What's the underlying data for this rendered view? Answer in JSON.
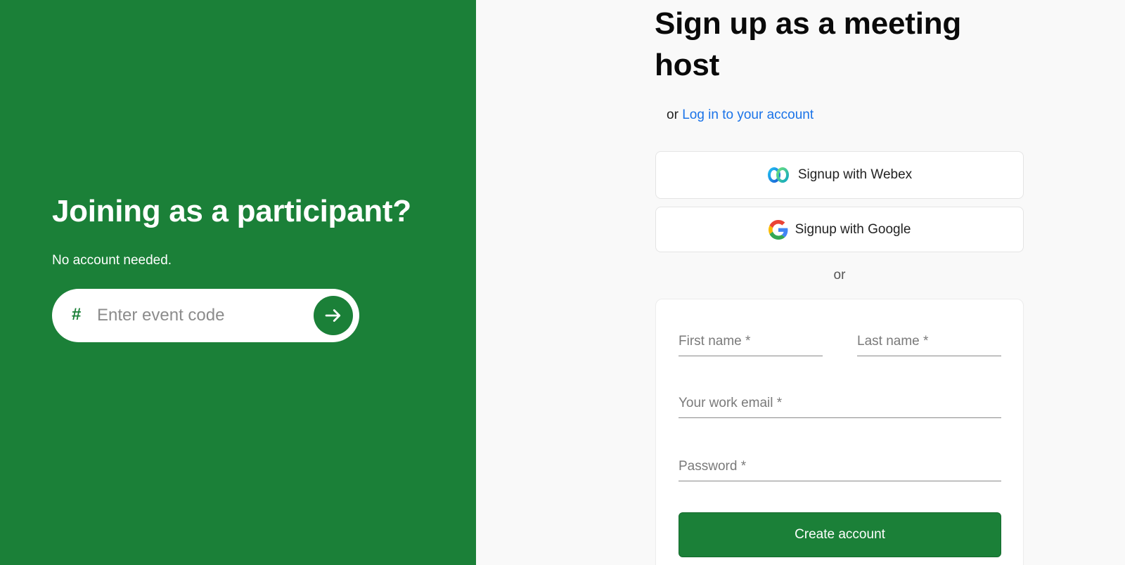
{
  "participant": {
    "title": "Joining as a participant?",
    "subtitle": "No account needed.",
    "event_code_placeholder": "Enter event code",
    "hash_symbol": "#",
    "submit_icon": "arrow-right-icon"
  },
  "host": {
    "title": "Sign up as a meeting host",
    "login_prefix": "or",
    "login_link": "Log in to your account",
    "webex_label": "Signup with Webex",
    "webex_icon": "webex-logo-icon",
    "google_label": "Signup with Google",
    "google_icon": "google-logo-icon",
    "separator": "or",
    "form": {
      "first_name_placeholder": "First name *",
      "last_name_placeholder": "Last name *",
      "email_placeholder": "Your work email *",
      "password_placeholder": "Password *",
      "submit_label": "Create account"
    }
  },
  "colors": {
    "brand_green": "#1b8038",
    "link_blue": "#1a73e8",
    "page_background": "#f9f9f9"
  }
}
